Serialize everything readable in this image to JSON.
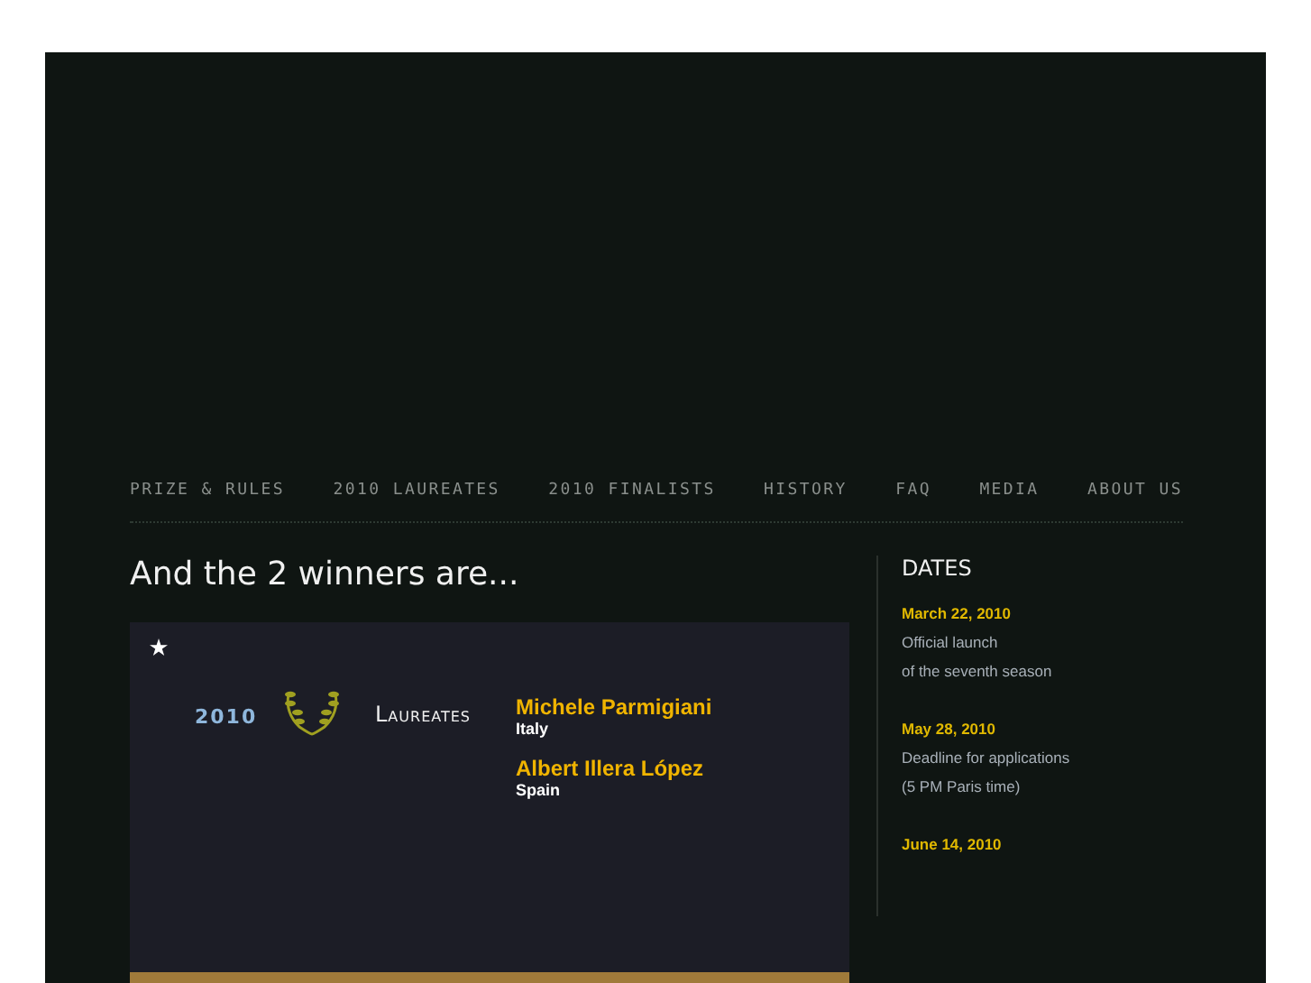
{
  "nav": [
    {
      "label": "PRIZE & RULES",
      "selected": false
    },
    {
      "label": "2010 LAUREATES",
      "selected": false
    },
    {
      "label": "2010 FINALISTS",
      "selected": false
    },
    {
      "label": "HISTORY",
      "selected": false
    },
    {
      "label": "FAQ",
      "selected": false
    },
    {
      "label": "MEDIA",
      "selected": false
    },
    {
      "label": "ABOUT US",
      "selected": false
    }
  ],
  "heading": "And the 2 winners are...",
  "card": {
    "year": "2010",
    "title": "Laureates",
    "laureates": [
      {
        "name": "Michele Parmigiani",
        "country": "Italy"
      },
      {
        "name": "Albert Illera López",
        "country": "Spain"
      }
    ]
  },
  "dates": {
    "title": "DATES",
    "items": [
      {
        "date": "March 22, 2010",
        "lines": [
          "Official launch",
          "of the seventh season"
        ]
      },
      {
        "date": "May 28, 2010",
        "lines": [
          "Deadline for applications",
          "(5 PM Paris time)"
        ]
      },
      {
        "date": "June 14, 2010"
      }
    ]
  }
}
